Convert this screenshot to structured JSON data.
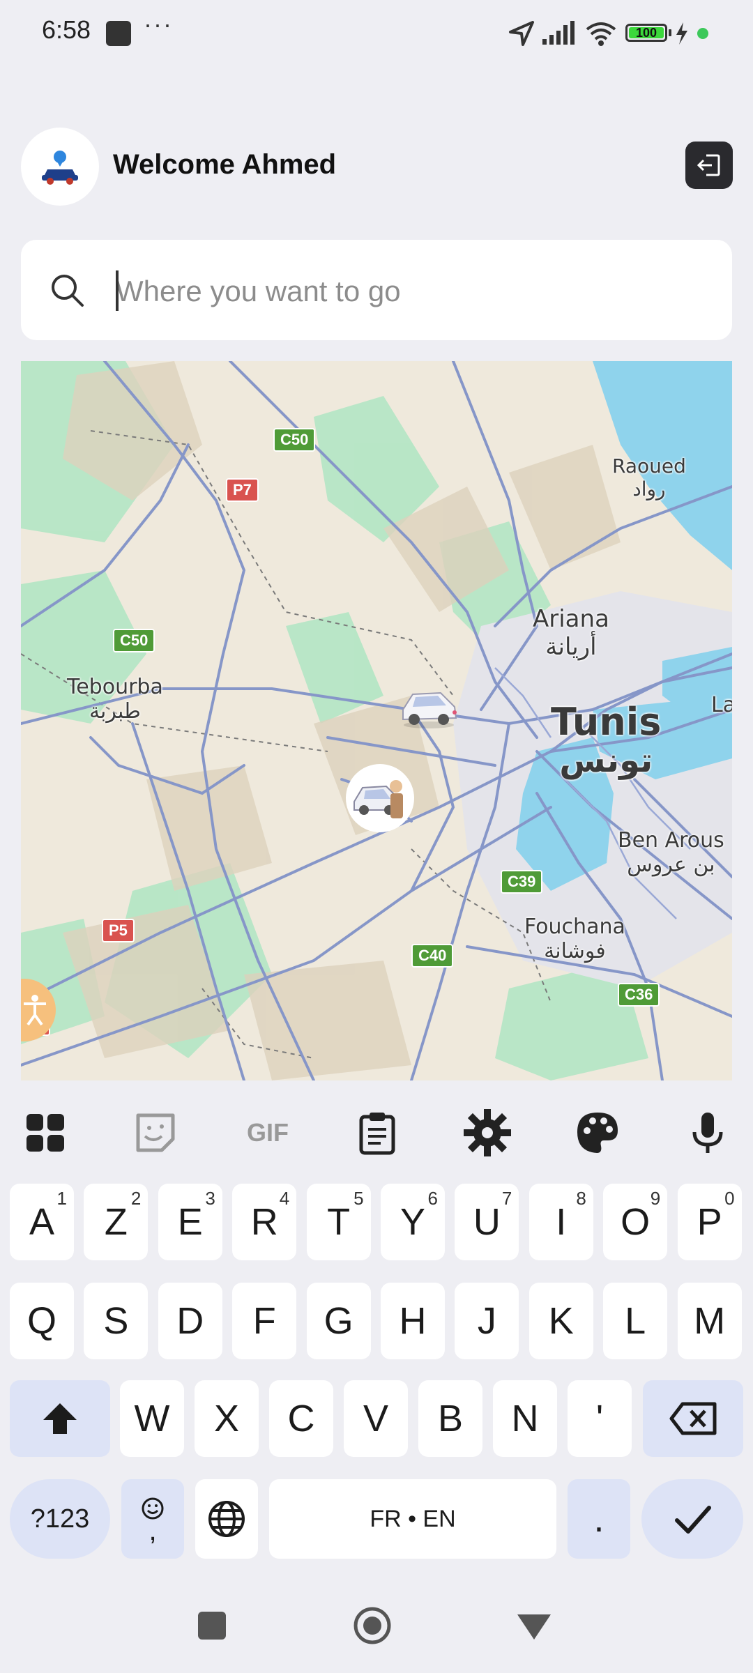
{
  "status_bar": {
    "time": "6:58",
    "dots": "···",
    "battery": "100"
  },
  "header": {
    "welcome": "Welcome Ahmed"
  },
  "search": {
    "placeholder": "Where you want to go"
  },
  "map": {
    "places": [
      {
        "name": "Raoued",
        "sub": "رواد"
      },
      {
        "name": "Ariana",
        "sub": "أريانة"
      },
      {
        "name": "Tunis",
        "sub": "تونس"
      },
      {
        "name": "Tebourba",
        "sub": "طبربة"
      },
      {
        "name": "Ben Arous",
        "sub": "بن عروس"
      },
      {
        "name": "Fouchana",
        "sub": "فوشانة"
      },
      {
        "name": "La"
      }
    ],
    "roads": [
      "C50",
      "P7",
      "C50",
      "C39",
      "C40",
      "C36",
      "P5",
      "A3"
    ]
  },
  "keyboard": {
    "tools": [
      "apps-icon",
      "sticker-icon",
      "gif-icon",
      "clipboard-icon",
      "settings-icon",
      "palette-icon",
      "mic-icon"
    ],
    "gif_label": "GIF",
    "row1": [
      {
        "k": "A",
        "h": "1"
      },
      {
        "k": "Z",
        "h": "2"
      },
      {
        "k": "E",
        "h": "3"
      },
      {
        "k": "R",
        "h": "4"
      },
      {
        "k": "T",
        "h": "5"
      },
      {
        "k": "Y",
        "h": "6"
      },
      {
        "k": "U",
        "h": "7"
      },
      {
        "k": "I",
        "h": "8"
      },
      {
        "k": "O",
        "h": "9"
      },
      {
        "k": "P",
        "h": "0"
      }
    ],
    "row2": [
      "Q",
      "S",
      "D",
      "F",
      "G",
      "H",
      "J",
      "K",
      "L",
      "M"
    ],
    "row3": [
      "W",
      "X",
      "C",
      "V",
      "B",
      "N",
      "'"
    ],
    "symbols_label": "?123",
    "emoji_comma": ",",
    "space_label": "FR • EN",
    "period_label": "."
  },
  "colors": {
    "accent": "#dde3f6",
    "map_water": "#8fd3ec",
    "map_green": "#a9e6c0",
    "road": "#8696c8"
  }
}
